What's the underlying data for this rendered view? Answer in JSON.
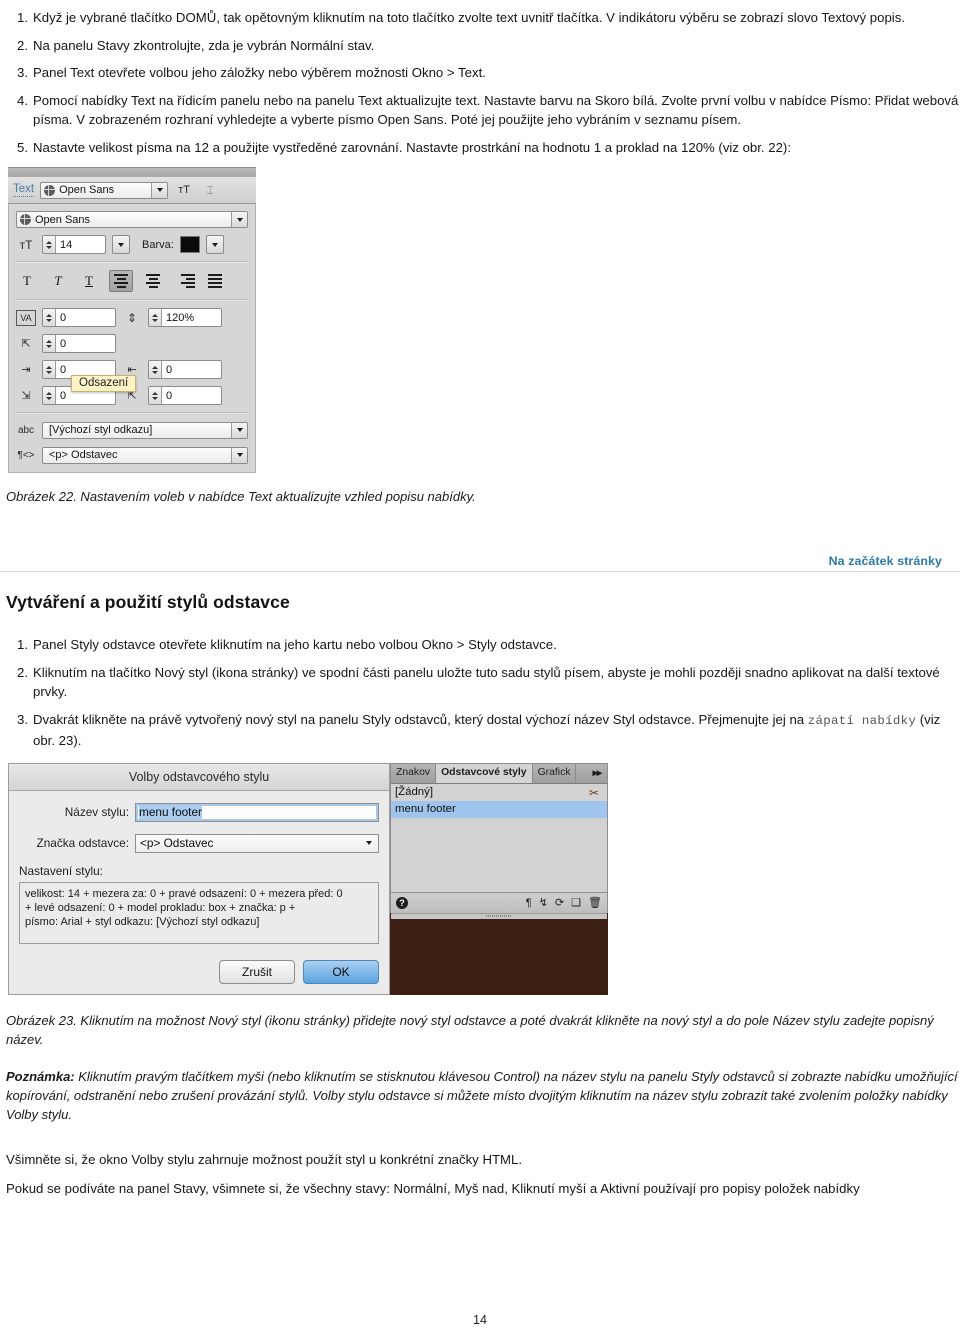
{
  "steps_top": [
    {
      "num": "1.",
      "text": "Když je vybrané tlačítko DOMŮ, tak opětovným kliknutím na toto tlačítko zvolte text uvnitř tlačítka. V indikátoru výběru se zobrazí slovo Textový popis."
    },
    {
      "num": "2.",
      "text": "Na panelu Stavy zkontrolujte, zda je vybrán Normální stav."
    },
    {
      "num": "3.",
      "text": "Panel Text otevřete volbou jeho záložky nebo výběrem možnosti Okno > Text."
    },
    {
      "num": "4.",
      "text": "Pomocí nabídky Text na řídicím panelu nebo na panelu Text aktualizujte text. Nastavte barvu na Skoro bílá. Zvolte první volbu v nabídce Písmo: Přidat webová písma. V zobrazeném rozhraní vyhledejte a vyberte písmo Open Sans. Poté jej použijte jeho vybráním v seznamu písem."
    },
    {
      "num": "5.",
      "text": "Nastavte velikost písma na 12 a použijte vystředěné zarovnání. Nastavte prostrkání na hodnotu 1 a proklad na 120% (viz obr. 22):"
    }
  ],
  "figure22": {
    "panel_tab_label": "Text",
    "top_font_value": "Open Sans",
    "font_value": "Open Sans",
    "size_value": "14",
    "color_label": "Barva:",
    "color_hex": "#0b0b0b",
    "style_buttons": [
      "T",
      "T",
      "T"
    ],
    "align_buttons": [
      "left",
      "center",
      "right",
      "justify"
    ],
    "tracking_value": "0",
    "leading_value": "120%",
    "baseline_value": "0",
    "indent_left_value": "0",
    "indent_right_value": "0",
    "space_before_value": "0",
    "space_after_value": "0",
    "tooltip": "Odsazení",
    "link_style_value": "[Výchozí styl odkazu]",
    "paragraph_tag_value": "<p> Odstavec"
  },
  "caption22": "Obrázek 22. Nastavením voleb v nabídce Text aktualizujte vzhled popisu nabídky.",
  "top_link": "Na začátek stránky",
  "section_heading": "Vytváření a použití stylů odstavce",
  "steps_bottom": [
    {
      "num": "1.",
      "text": "Panel Styly odstavce otevřete kliknutím na jeho kartu nebo volbou Okno > Styly odstavce."
    },
    {
      "num": "2.",
      "text": "Kliknutím na tlačítko Nový styl (ikona stránky) ve spodní části panelu uložte tuto sadu stylů písem, abyste je mohli později snadno aplikovat na další textové prvky."
    }
  ],
  "step3": {
    "num": "3.",
    "part1": "Dvakrát klikněte na právě vytvořený nový styl na panelu Styly odstavců, který dostal výchozí název Styl odstavce. Přejmenujte jej na ",
    "mono": "zápatí nabídky",
    "part2": " (viz obr. 23)."
  },
  "figure23": {
    "dialog": {
      "title": "Volby odstavcového stylu",
      "name_label": "Název stylu:",
      "name_value": "menu footer",
      "tag_label": "Značka odstavce:",
      "tag_value": "<p> Odstavec",
      "settings_label": "Nastavení stylu:",
      "settings_lines": [
        "velikost: 14 + mezera za: 0 + pravé odsazení: 0 + mezera před: 0",
        "+ levé odsazení: 0 + model prokladu: box + značka: p +",
        "písmo: Arial + styl odkazu: [Výchozí styl odkazu]"
      ],
      "cancel_label": "Zrušit",
      "ok_label": "OK"
    },
    "panel": {
      "tabs": [
        {
          "label": "Znakov",
          "active": false
        },
        {
          "label": "Odstavcové styly",
          "active": true
        },
        {
          "label": "Grafick",
          "active": false
        }
      ],
      "overflow": "▸▸",
      "items": [
        {
          "label": "[Žádný]",
          "selected": false
        },
        {
          "label": "menu footer",
          "selected": true
        }
      ],
      "footer_icons": [
        "help-icon",
        "paragraph-icon",
        "unlink-icon",
        "break-link-icon",
        "new-style-icon",
        "delete-icon"
      ]
    }
  },
  "caption23": "Obrázek 23. Kliknutím na možnost Nový styl (ikonu stránky) přidejte nový styl odstavce a poté dvakrát klikněte na nový styl a do pole Název stylu zadejte popisný název.",
  "note": {
    "label": "Poznámka:",
    "text": " Kliknutím pravým tlačítkem myši (nebo kliknutím se stisknutou klávesou Control) na název stylu na panelu Styly odstavců si zobrazte nabídku umožňující kopírování, odstranění nebo zrušení provázání stylů. Volby stylu odstavce si můžete místo dvojitým kliknutím na název stylu zobrazit také zvolením položky nabídky Volby stylu."
  },
  "body_lines": [
    "Všimněte si, že okno Volby stylu zahrnuje možnost použít styl u konkrétní značky HTML.",
    "Pokud se podíváte na panel Stavy, všimnete si, že všechny stavy: Normální, Myš nad, Kliknutí myší a Aktivní používají pro popisy položek nabídky"
  ],
  "page_number": "14"
}
